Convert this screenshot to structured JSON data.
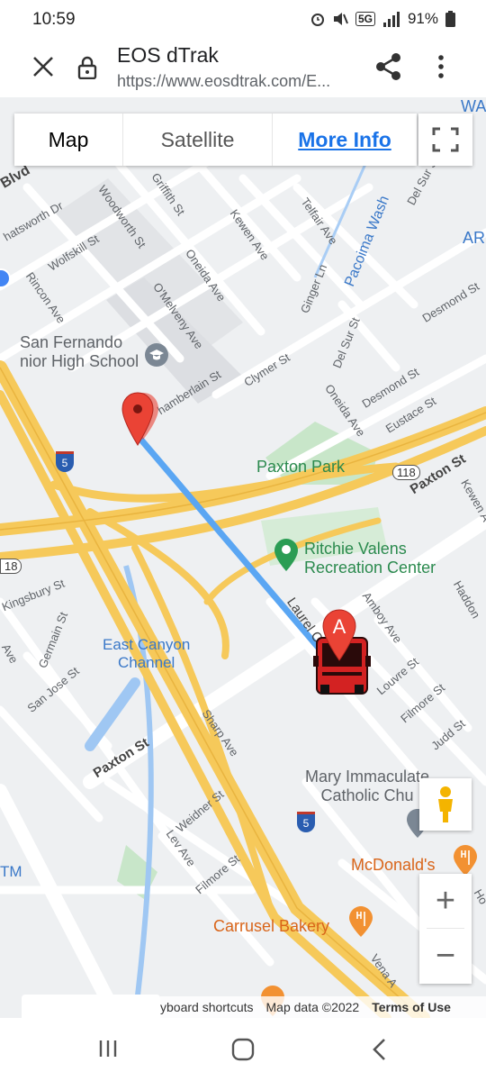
{
  "status_bar": {
    "time": "10:59",
    "battery": "91%",
    "network": "5G"
  },
  "browser": {
    "title": "EOS dTrak",
    "url": "https://www.eosdtrak.com/E...",
    "icons": [
      "close-icon",
      "lock-icon",
      "share-icon",
      "more-vert-icon"
    ]
  },
  "map_controls": {
    "tab_map": "Map",
    "tab_satellite": "Satellite",
    "more_info": "More Info"
  },
  "markers": {
    "bus_marker_letter": "A"
  },
  "labels": {
    "blvd": "Blvd",
    "hatsworth": "hatsworth Dr",
    "woodworth": "Woodworth St",
    "griffith": "Griffith St",
    "kewen": "Kewen Ave",
    "telfair": "Telfair Ave",
    "pacoima": "Pacoima Wash",
    "delsur_top": "Del Sur St",
    "wolfskill": "Wolfskill St",
    "oneida": "Oneida Ave",
    "ginger": "Ginger Ln",
    "desmond_right": "Desmond St",
    "rincon": "Rincon Ave",
    "omelveny": "O'Melveny Ave",
    "delsur_mid": "Del Sur St",
    "school": "San Fernando\nnior High School",
    "chamberlain": "hamberlain St",
    "clymer": "Clymer St",
    "desmond_mid": "Desmond St",
    "oneida2": "Oneida Ave",
    "eustace": "Eustace St",
    "paxton_park": "Paxton Park",
    "route118": "118",
    "route118_left": "18",
    "paxton_right": "Paxton St",
    "kewen2": "Kewen A",
    "interstate5": "5",
    "ritchie": "Ritchie Valens\nRecreation Center",
    "kingsbury": "Kingsbury St",
    "haddon": "Haddon",
    "amboy": "Amboy Ave",
    "laurel": "Laurel C",
    "germain": "Germain St",
    "east_canyon": "East Canyon\nChannel",
    "san_jose": "San Jose St",
    "louvre": "Louvre St",
    "filmore_right": "Filmore St",
    "ave_left": "Ave",
    "judd": "Judd St",
    "sharp": "Sharp Ave",
    "paxton_left": "Paxton St",
    "mary": "Mary Immaculate\nCatholic Chu",
    "weidner": "Weidner St",
    "lev": "Lev Ave",
    "filmore_left": "Filmore St",
    "tm": "TM",
    "mcdonalds": "McDonald's",
    "carrusel": "Carrusel Bakery",
    "vena": "Vena A",
    "ar": "AR",
    "wa": "WA",
    "ho": "Ho"
  },
  "attribution": {
    "shortcuts": "yboard shortcuts",
    "mapdata": "Map data ©2022",
    "terms": "Terms of Use"
  },
  "colors": {
    "route_blue": "#5aa6f3",
    "highway": "#f6c95a",
    "park": "#c8e6c9",
    "water": "#9fc7f3",
    "marker_red": "#ea4335",
    "bus_red": "#d32222",
    "link_blue": "#1a73e8"
  }
}
